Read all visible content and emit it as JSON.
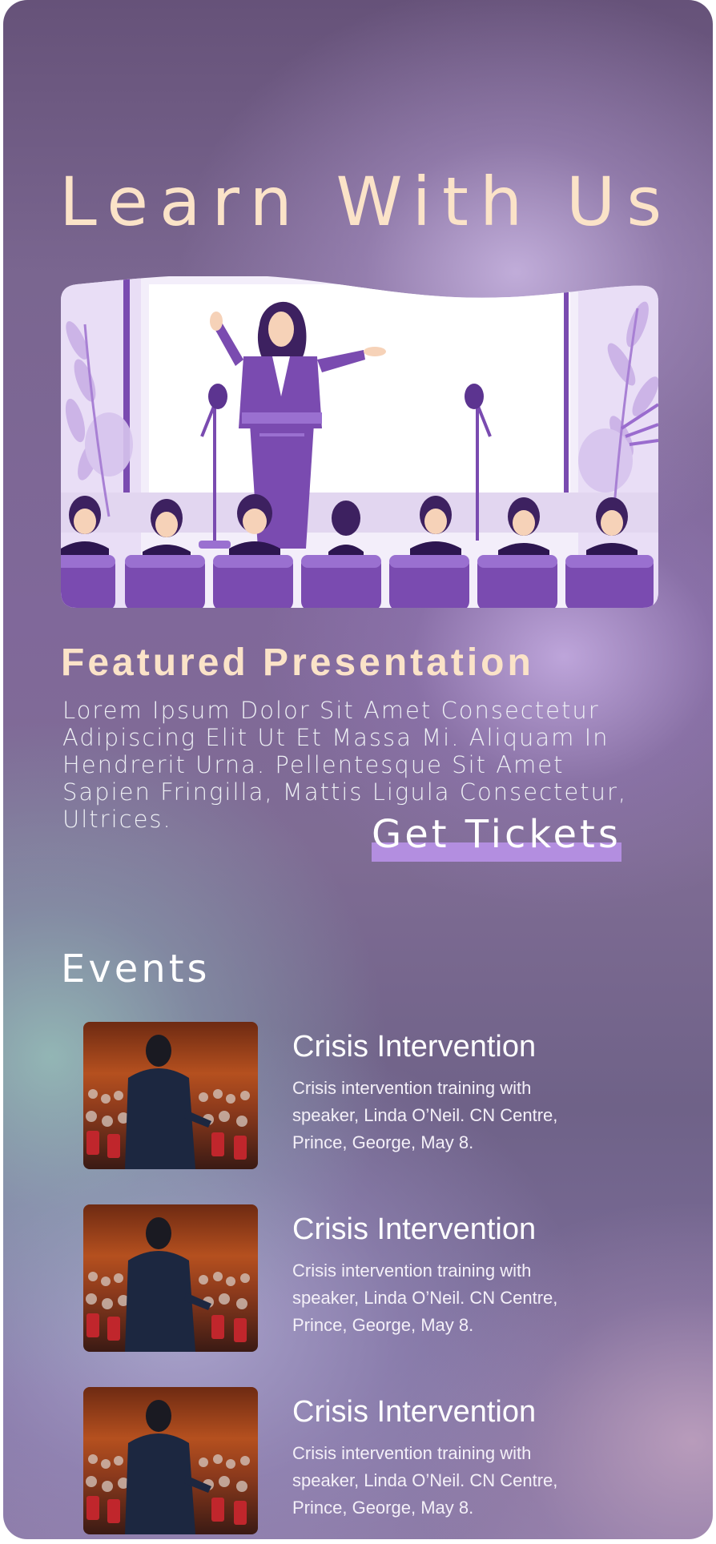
{
  "hero": {
    "title": "Learn With Us",
    "illustration": "speaker-at-podium-illustration"
  },
  "featured": {
    "title": "Featured Presentation",
    "body": "Lorem Ipsum Dolor Sit Amet Consectetur Adipiscing Elit Ut Et Massa Mi. Aliquam In Hendrerit Urna. Pellentesque Sit Amet Sapien Fringilla, Mattis Ligula Consectetur, Ultrices.",
    "cta_label": "Get Tickets"
  },
  "events": {
    "title": "Events",
    "items": [
      {
        "title": "Crisis Intervention",
        "description": "Crisis intervention training with speaker, Linda O’Neil. CN Centre, Prince, George, May 8.",
        "image": "speaker-audience-photo"
      },
      {
        "title": "Crisis Intervention",
        "description": "Crisis intervention training with speaker, Linda O’Neil. CN Centre, Prince, George, May 8.",
        "image": "speaker-audience-photo"
      },
      {
        "title": "Crisis Intervention",
        "description": "Crisis intervention training with speaker, Linda O’Neil. CN Centre, Prince, George, May 8.",
        "image": "speaker-audience-photo"
      }
    ]
  },
  "colors": {
    "title_cream": "#fbe3c8",
    "accent_purple": "#b38ee0",
    "illustration_purple": "#7a4bb0"
  }
}
